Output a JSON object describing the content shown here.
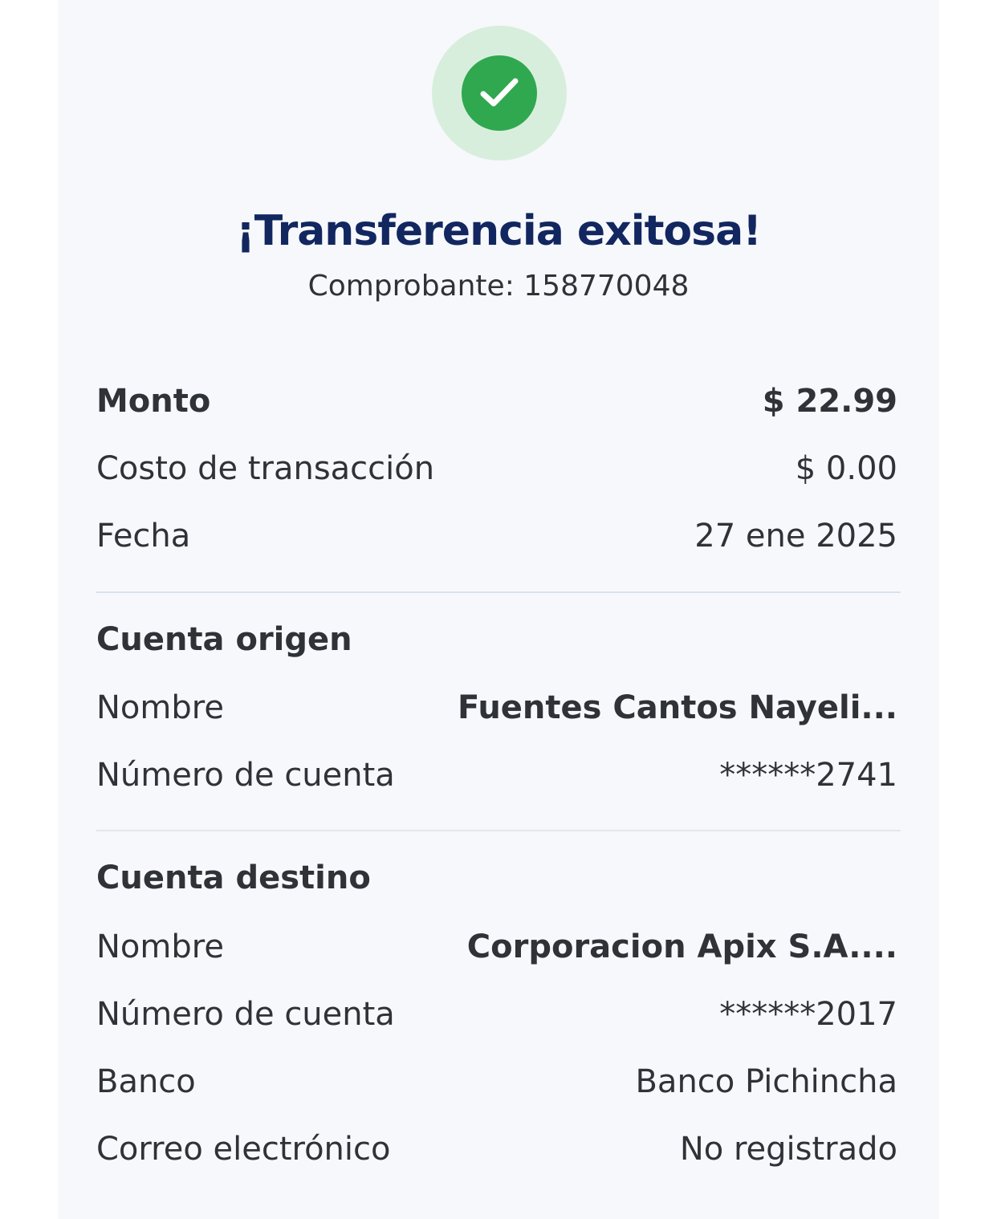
{
  "header": {
    "status_icon": "checkmark-icon",
    "title": "¡Transferencia exitosa!",
    "receipt_label": "Comprobante: 158770048"
  },
  "summary": {
    "amount_label": "Monto",
    "amount_value": "$ 22.99",
    "fee_label": "Costo de transacción",
    "fee_value": "$ 0.00",
    "date_label": "Fecha",
    "date_value": "27 ene 2025"
  },
  "origin": {
    "section_title": "Cuenta origen",
    "name_label": "Nombre",
    "name_value": "Fuentes Cantos Nayeli...",
    "account_label": "Número de cuenta",
    "account_value": "******2741"
  },
  "destination": {
    "section_title": "Cuenta destino",
    "name_label": "Nombre",
    "name_value": "Corporacion Apix S.A....",
    "account_label": "Número de cuenta",
    "account_value": "******2017",
    "bank_label": "Banco",
    "bank_value": "Banco Pichincha",
    "email_label": "Correo electrónico",
    "email_value": "No registrado"
  },
  "colors": {
    "background": "#f7f8fb",
    "title": "#12275f",
    "text": "#2f3237",
    "success": "#2fa84f",
    "success_halo": "#d8eedd",
    "divider_1": "#d5e3ef",
    "divider_2": "#e4e6ea"
  }
}
